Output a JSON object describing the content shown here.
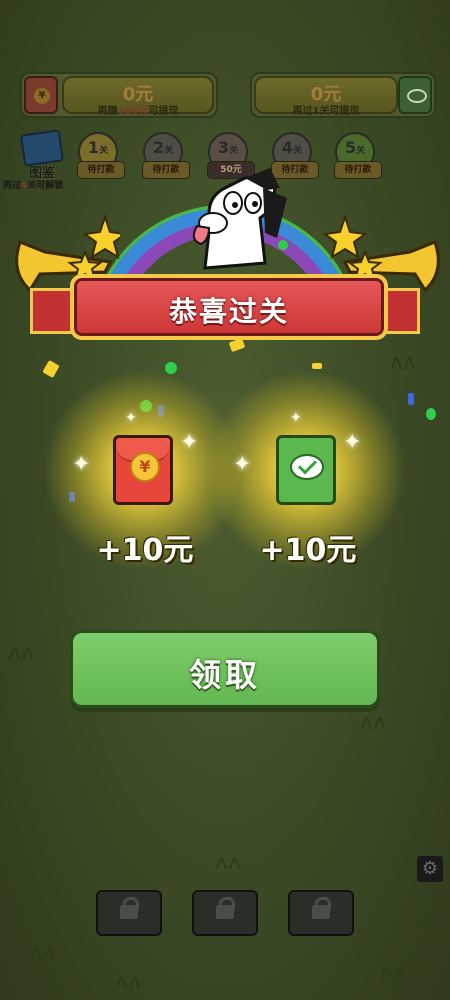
{
  "top": {
    "left_money": {
      "amount": "0元",
      "hint_prefix": "再赚",
      "hint_value": "100元",
      "hint_suffix": "可提现"
    },
    "right_money": {
      "amount": "0元",
      "hint": "再过1关可提现"
    }
  },
  "atlas": {
    "label": "图鉴",
    "hint_prefix": "再过",
    "hint_value": "4",
    "hint_suffix": "关可解锁"
  },
  "levels": [
    {
      "num": "1",
      "suffix": "关",
      "tag": "待打款"
    },
    {
      "num": "2",
      "suffix": "关",
      "tag": "待打款"
    },
    {
      "num": "3",
      "suffix": "关",
      "tag": "50元"
    },
    {
      "num": "4",
      "suffix": "关",
      "tag": "待打款"
    },
    {
      "num": "5",
      "suffix": "关",
      "tag": "待打款"
    }
  ],
  "banner": {
    "title": "恭喜过关"
  },
  "rewards": [
    {
      "type": "red-envelope",
      "symbol": "¥",
      "label": "+10元"
    },
    {
      "type": "wechat-envelope",
      "label": "+10元"
    }
  ],
  "claim": {
    "label": "领取"
  },
  "icons": {
    "settings": "gear-icon",
    "lock": "lock-icon"
  },
  "colors": {
    "accent_green": "#6ec05c",
    "banner_red": "#d94040",
    "gold": "#f6c94a"
  }
}
